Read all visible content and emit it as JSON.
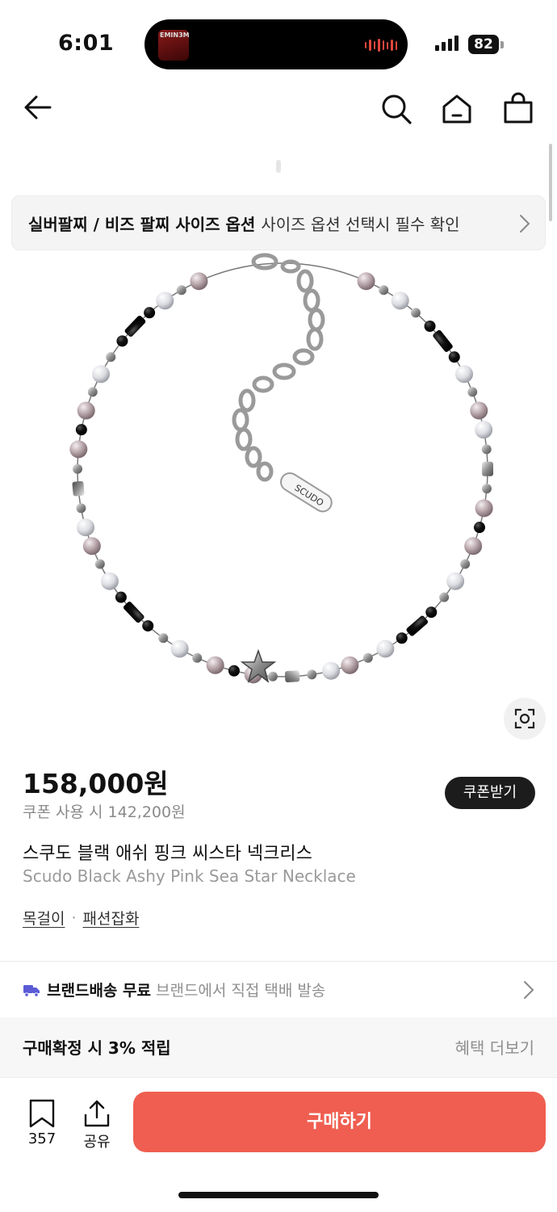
{
  "status_bar": {
    "time": "6:01",
    "now_playing_art_text": "EMIN3M",
    "battery": "82"
  },
  "nav": {
    "back_icon": "back-arrow-icon",
    "search_icon": "search-icon",
    "home_icon": "home-icon",
    "bag_icon": "shopping-bag-icon"
  },
  "option_banner": {
    "title": "실버팔찌 / 비즈 팔찌 사이즈 옵션",
    "subtitle": "사이즈 옵션 선택시 필수 확인"
  },
  "product": {
    "image_brand_tag": "SCUDO",
    "price": "158,000원",
    "coupon_price": "쿠폰 사용 시 142,200원",
    "coupon_button": "쿠폰받기",
    "name_ko": "스쿠도 블랙 애쉬 핑크 씨스타 넥크리스",
    "name_en": "Scudo Black Ashy Pink Sea Star Necklace",
    "categories": [
      "목걸이",
      "패션잡화"
    ],
    "category_separator": "·"
  },
  "shipping": {
    "label": "브랜드배송 무료",
    "detail": "브랜드에서 직접 택배 발송"
  },
  "benefit": {
    "label": "구매확정 시 3% 적립",
    "more": "혜택 더보기"
  },
  "bottom_bar": {
    "bookmark_count": "357",
    "share_label": "공유",
    "buy_label": "구매하기"
  },
  "colors": {
    "buy_button": "#ef5e50",
    "coupon_button": "#1c1c1c",
    "shipping_truck": "#5b5bd6"
  }
}
